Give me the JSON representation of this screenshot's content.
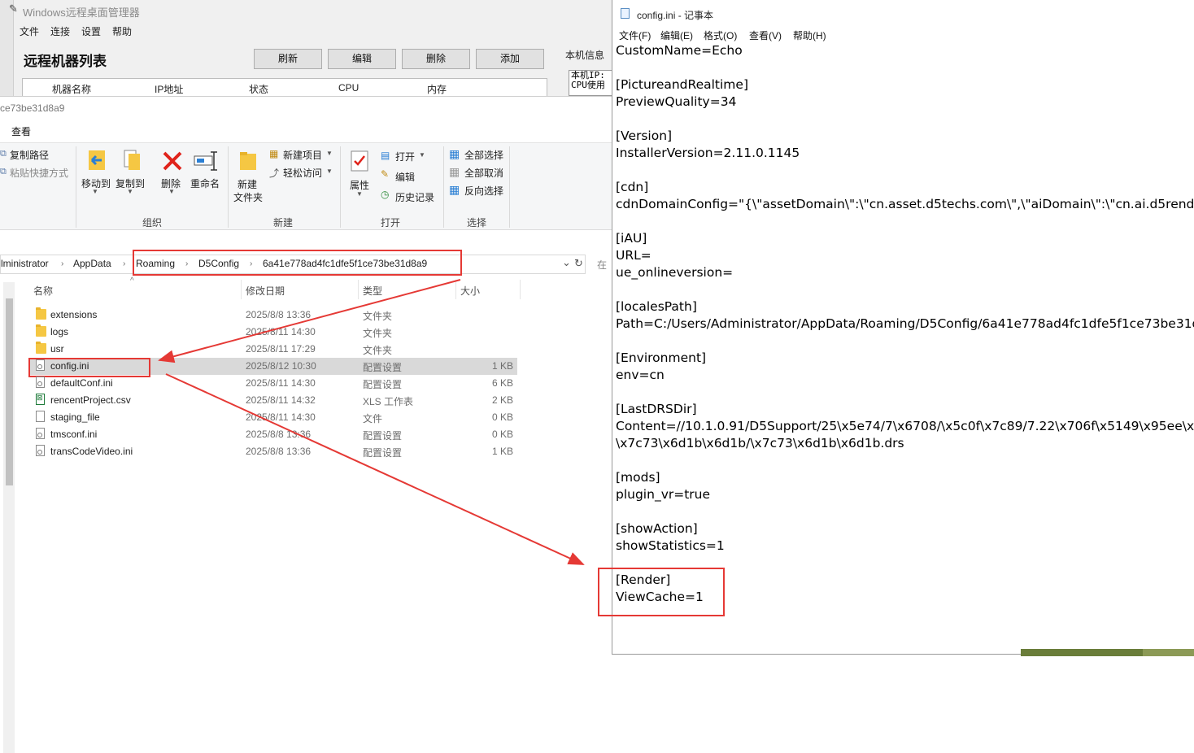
{
  "remote_manager": {
    "title": "Windows远程桌面管理器",
    "menu": [
      "文件",
      "连接",
      "设置",
      "帮助"
    ],
    "heading": "远程机器列表",
    "buttons": [
      "刷新",
      "编辑",
      "删除",
      "添加"
    ],
    "columns": [
      "机器名称",
      "IP地址",
      "状态",
      "CPU",
      "内存"
    ],
    "info_title": "本机信息",
    "info_lines": [
      "本机IP:",
      "CPU使用"
    ]
  },
  "explorer": {
    "path_title": "ce73be31d8a9",
    "tab": "查看",
    "ribbon": {
      "clipboard": [
        "复制路径",
        "粘贴快捷方式"
      ],
      "organize": {
        "move_to": "移动到",
        "copy_to": "复制到",
        "delete": "删除",
        "rename": "重命名",
        "group": "组织"
      },
      "new": {
        "new_folder_1": "新建",
        "new_folder_2": "文件夹",
        "new_item": "新建项目",
        "easy_access": "轻松访问",
        "group": "新建"
      },
      "open": {
        "properties": "属性",
        "open": "打开",
        "edit": "编辑",
        "history": "历史记录",
        "group": "打开"
      },
      "select": {
        "select_all": "全部选择",
        "select_none": "全部取消",
        "invert": "反向选择",
        "group": "选择"
      }
    },
    "address": [
      "lministrator",
      "AppData",
      "Roaming",
      "D5Config",
      "6a41e778ad4fc1dfe5f1ce73be31d8a9"
    ],
    "search_stub": "在",
    "columns": {
      "name": "名称",
      "date": "修改日期",
      "type": "类型",
      "size": "大小"
    },
    "files": [
      {
        "name": "extensions",
        "date": "2025/8/8 13:36",
        "type": "文件夹",
        "size": "",
        "icon": "folder-icon"
      },
      {
        "name": "logs",
        "date": "2025/8/11 14:30",
        "type": "文件夹",
        "size": "",
        "icon": "folder-icon"
      },
      {
        "name": "usr",
        "date": "2025/8/11 17:29",
        "type": "文件夹",
        "size": "",
        "icon": "folder-icon"
      },
      {
        "name": "config.ini",
        "date": "2025/8/12 10:30",
        "type": "配置设置",
        "size": "1 KB",
        "icon": "config-file-icon"
      },
      {
        "name": "defaultConf.ini",
        "date": "2025/8/11 14:30",
        "type": "配置设置",
        "size": "6 KB",
        "icon": "config-file-icon"
      },
      {
        "name": "rencentProject.csv",
        "date": "2025/8/11 14:32",
        "type": "XLS 工作表",
        "size": "2 KB",
        "icon": "csv-file-icon"
      },
      {
        "name": "staging_file",
        "date": "2025/8/11 14:30",
        "type": "文件",
        "size": "0 KB",
        "icon": "file-icon"
      },
      {
        "name": "tmsconf.ini",
        "date": "2025/8/8 13:36",
        "type": "配置设置",
        "size": "0 KB",
        "icon": "config-file-icon"
      },
      {
        "name": "transCodeVideo.ini",
        "date": "2025/8/8 13:36",
        "type": "配置设置",
        "size": "1 KB",
        "icon": "config-file-icon"
      }
    ]
  },
  "notepad": {
    "title": "config.ini - 记事本",
    "menu": [
      "文件(F)",
      "编辑(E)",
      "格式(O)",
      "查看(V)",
      "帮助(H)"
    ],
    "content": "CustomName=Echo\n\n[PictureandRealtime]\nPreviewQuality=34\n\n[Version]\nInstallerVersion=2.11.0.1145\n\n[cdn]\ncdnDomainConfig=\"{\\\"assetDomain\\\":\\\"cn.asset.d5techs.com\\\",\\\"aiDomain\\\":\\\"cn.ai.d5render.com\\\"}\"\n\n[iAU]\nURL=\nue_onlineversion=\n\n[localesPath]\nPath=C:/Users/Administrator/AppData/Roaming/D5Config/6a41e778ad4fc1dfe5f1ce73be31d8a9\n\n[Environment]\nenv=cn\n\n[LastDRSDir]\nContent=//10.1.0.91/D5Support/25\\x5e74/7\\x6708/\\x5c0f\\x7c89/7.22\\x706f\\x5149\\x95ee\\x98\n\\x7c73\\x6d1b\\x6d1b/\\x7c73\\x6d1b\\x6d1b.drs\n\n[mods]\nplugin_vr=true\n\n[showAction]\nshowStatistics=1\n\n[Render]\nViewCache=1"
  },
  "colors": {
    "highlight_red": "#e53935",
    "selection_gray": "#d9d9d9"
  }
}
